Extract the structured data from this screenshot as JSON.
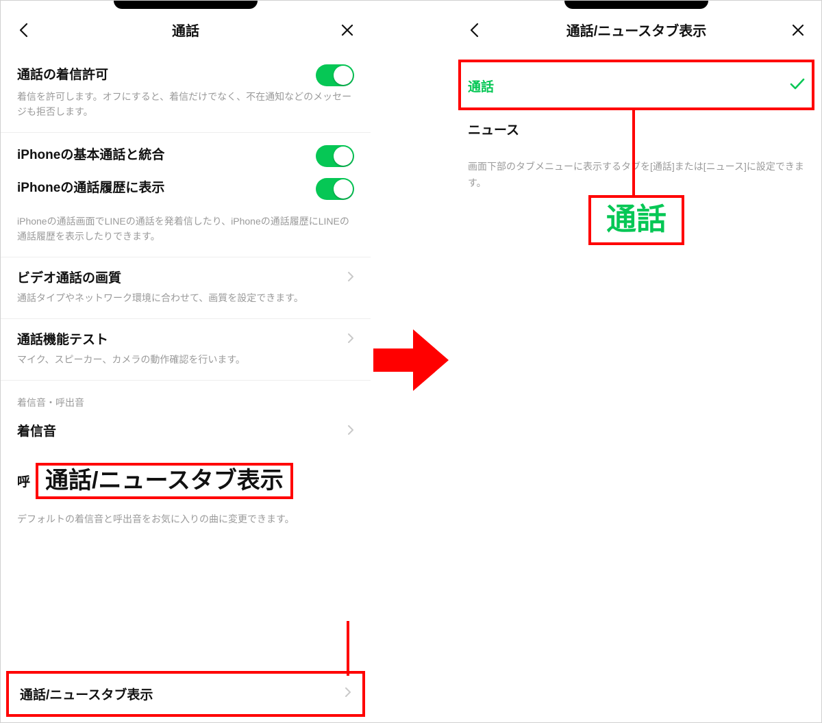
{
  "colors": {
    "accent": "#06c755",
    "annotation": "#ff0000"
  },
  "left": {
    "title": "通話",
    "rows": {
      "incoming": {
        "label": "通話の着信許可",
        "sub": "着信を許可します。オフにすると、着信だけでなく、不在通知などのメッセージも拒否します。",
        "on": true
      },
      "integrate": {
        "label": "iPhoneの基本通話と統合",
        "on": true
      },
      "history": {
        "label": "iPhoneの通話履歴に表示",
        "on": true
      },
      "history_sub": "iPhoneの通話画面でLINEの通話を発着信したり、iPhoneの通話履歴にLINEの通話履歴を表示したりできます。",
      "video": {
        "label": "ビデオ通話の画質",
        "sub": "通話タイプやネットワーク環境に合わせて、画質を設定できます。"
      },
      "test": {
        "label": "通話機能テスト",
        "sub": "マイク、スピーカー、カメラの動作確認を行います。"
      },
      "section_label": "着信音・呼出音",
      "ringtone": {
        "label": "着信音"
      },
      "truncated_prefix": "呼",
      "annot_box": "通話/ニュースタブ表示",
      "footer_sub": "デフォルトの着信音と呼出音をお気に入りの曲に変更できます。",
      "final_row": "通話/ニュースタブ表示"
    }
  },
  "right": {
    "title": "通話/ニュースタブ表示",
    "option_selected": "通話",
    "option_other": "ニュース",
    "sub": "画面下部のタブメニューに表示するタブを[通話]または[ニュース]に設定できます。",
    "annot_box": "通話"
  }
}
